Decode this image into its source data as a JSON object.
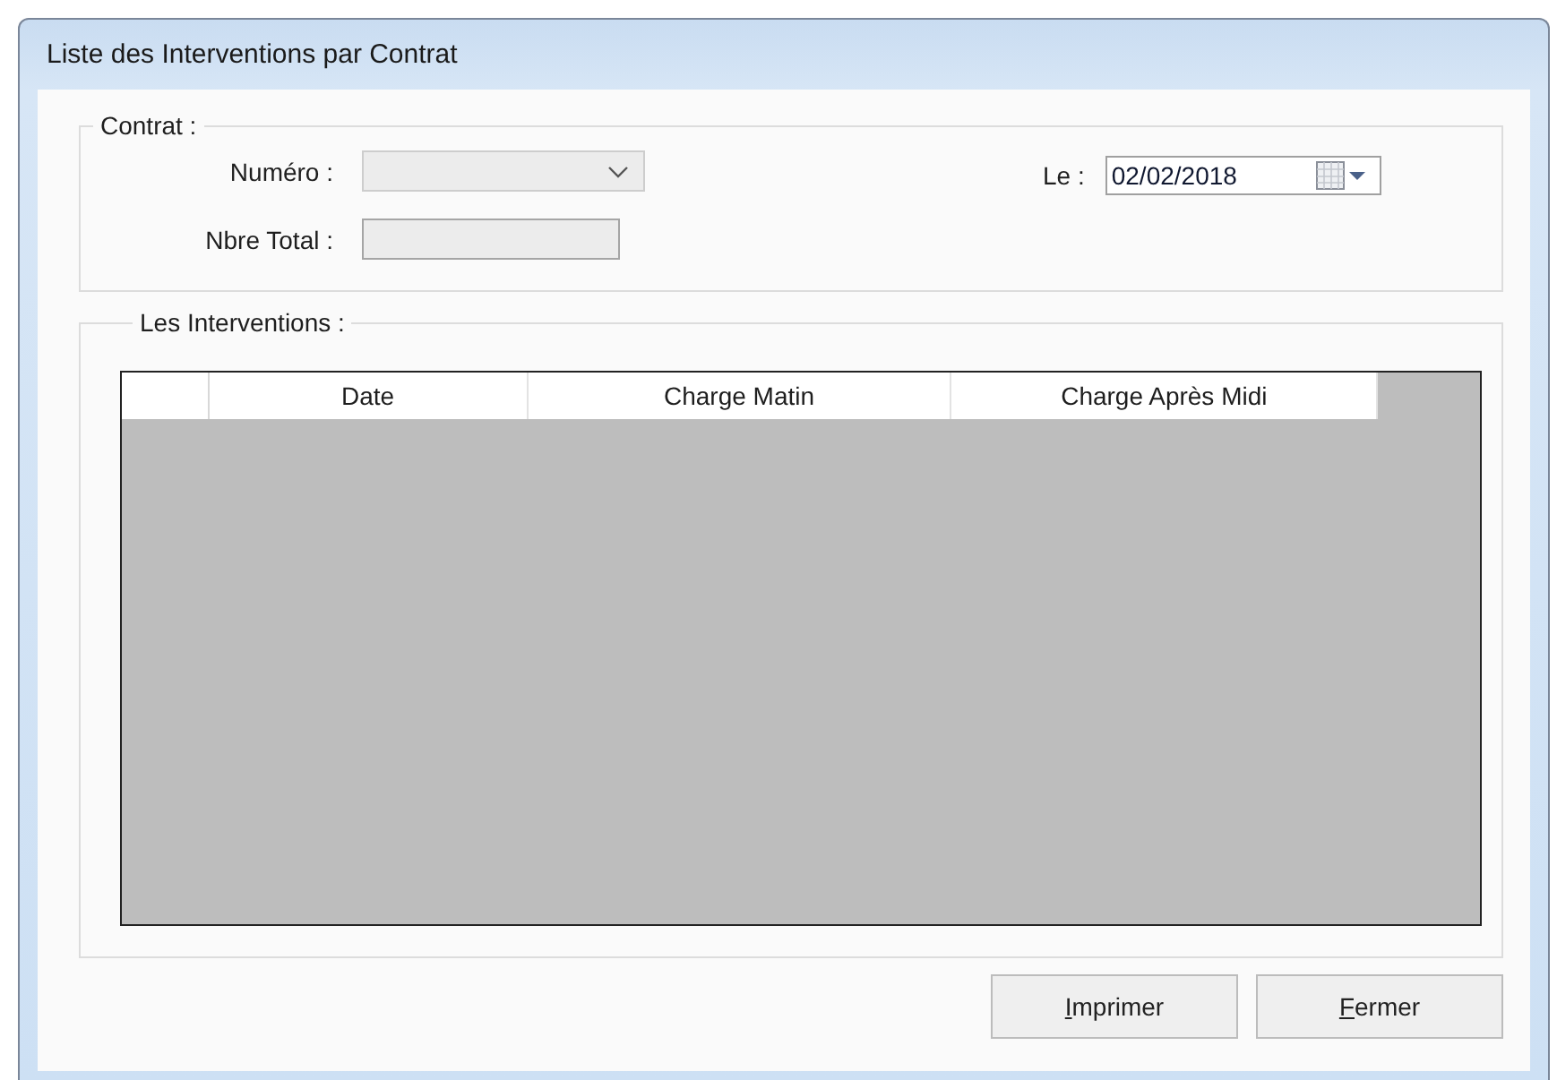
{
  "window": {
    "title": "Liste des Interventions par Contrat"
  },
  "contract": {
    "legend": "Contrat :",
    "number": {
      "label": "Numéro :",
      "disabled": true
    },
    "total": {
      "label": "Nbre Total :",
      "disabled": true
    },
    "date": {
      "label": "Le :",
      "value": "02/02/2018"
    }
  },
  "interventions": {
    "legend": "Les Interventions :",
    "columns": [
      "Date",
      "Charge Matin",
      "Charge Après Midi"
    ]
  },
  "buttons": [
    {
      "label": "Imprimer",
      "first_letter_underlined": true
    },
    {
      "label": "Fermer",
      "first_letter_underlined": true
    }
  ]
}
